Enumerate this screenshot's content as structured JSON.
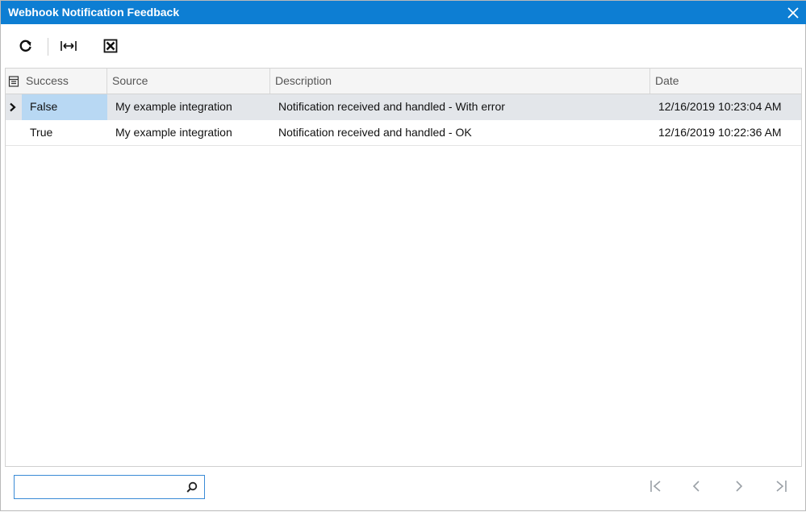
{
  "window": {
    "title": "Webhook Notification Feedback"
  },
  "toolbar": {
    "buttons": [
      {
        "name": "refresh",
        "icon": "refresh-icon"
      },
      {
        "name": "fit-columns",
        "icon": "fit-columns-icon"
      },
      {
        "name": "export-excel",
        "icon": "excel-export-icon"
      }
    ]
  },
  "grid": {
    "columns": [
      "Success",
      "Source",
      "Description",
      "Date"
    ],
    "rows": [
      {
        "success": "False",
        "source": "My example integration",
        "description": "Notification received and handled - With error",
        "date": "12/16/2019 10:23:04 AM",
        "selected": true
      },
      {
        "success": "True",
        "source": "My example integration",
        "description": "Notification received and handled - OK",
        "date": "12/16/2019 10:22:36 AM",
        "selected": false
      }
    ]
  },
  "search": {
    "value": "",
    "placeholder": ""
  },
  "pager": {
    "buttons": [
      "first-page",
      "previous-page",
      "next-page",
      "last-page"
    ]
  },
  "colors": {
    "titlebar": "#0d7ed3",
    "selected_row": "#e3e6ea",
    "selected_cell": "#b8d8f3",
    "pager_icon": "#9aa0a6"
  }
}
